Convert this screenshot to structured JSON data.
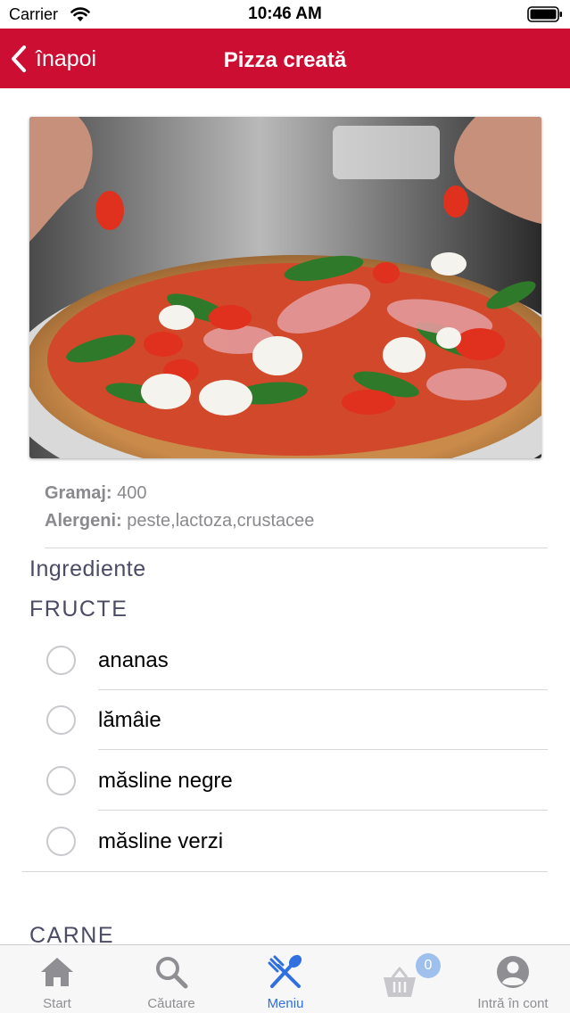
{
  "status_bar": {
    "carrier": "Carrier",
    "time": "10:46 AM"
  },
  "nav": {
    "back_label": "înapoi",
    "title": "Pizza creată"
  },
  "colors": {
    "brand_red": "#cc0e33",
    "active_tab": "#2f6fe0",
    "section_text": "#4b4b66",
    "badge": "#9fc0ec"
  },
  "details": {
    "gramaj_label": "Gramaj:",
    "gramaj_value": "400",
    "alergeni_label": "Alergeni:",
    "alergeni_value": "peste,lactoza,crustacee"
  },
  "ingredients": {
    "title": "Ingrediente",
    "groups": [
      {
        "name": "FRUCTE",
        "items": [
          "ananas",
          "lămâie",
          "măsline negre",
          "măsline verzi"
        ]
      },
      {
        "name": "CARNE",
        "items": []
      }
    ]
  },
  "tab_bar": {
    "tabs": [
      {
        "label": "Start",
        "icon": "home-icon",
        "active": false
      },
      {
        "label": "Căutare",
        "icon": "search-icon",
        "active": false
      },
      {
        "label": "Meniu",
        "icon": "utensils-icon",
        "active": true
      },
      {
        "label": "",
        "icon": "basket-icon",
        "active": false
      },
      {
        "label": "Intră în cont",
        "icon": "account-icon",
        "active": false
      }
    ],
    "cart_count": "0"
  }
}
